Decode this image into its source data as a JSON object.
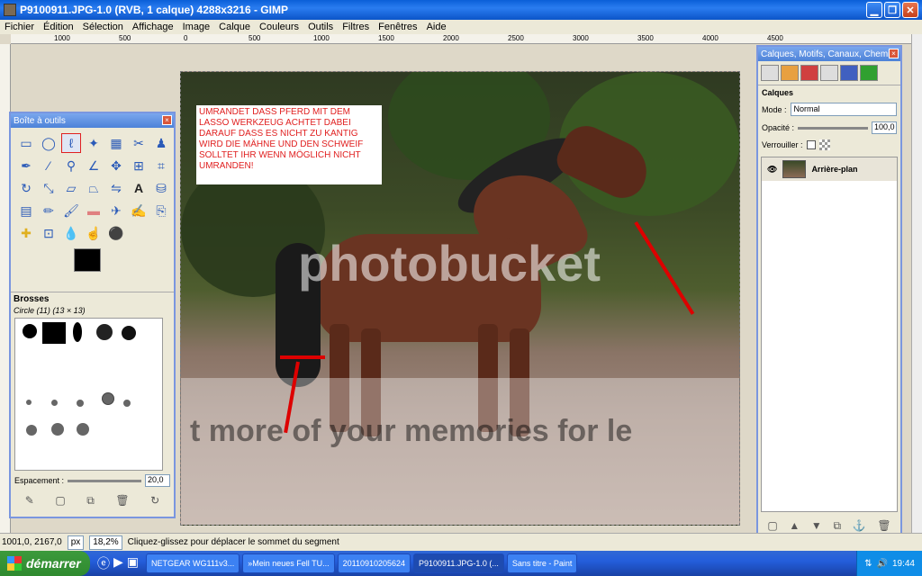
{
  "window": {
    "title": "P9100911.JPG-1.0 (RVB, 1 calque) 4288x3216 - GIMP",
    "controls": [
      "minimize-icon",
      "maximize-icon",
      "close-icon"
    ]
  },
  "menu": [
    "Fichier",
    "Édition",
    "Sélection",
    "Affichage",
    "Image",
    "Calque",
    "Couleurs",
    "Outils",
    "Filtres",
    "Fenêtres",
    "Aide"
  ],
  "ruler": {
    "ticks": [
      "1000",
      "500",
      "0",
      "500",
      "1000",
      "1500",
      "2000",
      "2500",
      "3000",
      "3500",
      "4000",
      "4500"
    ]
  },
  "canvas": {
    "note": "UMRANDET DASS PFERD MIT DEM LASSO WERKZEUG ACHTET DABEI DARAUF DASS ES NICHT ZU KANTIG WIRD DIE MÄHNE UND DEN SCHWEIF SOLLTET IHR WENN MÖGLICH NICHT UMRANDEN!",
    "watermark": "photobucket",
    "watermark_tagline": "t more of your memories for le",
    "annotation_color": "#dd0000"
  },
  "toolbox": {
    "title": "Boîte à outils",
    "close": "×",
    "tools": [
      "rect-select-icon",
      "ellipse-select-icon",
      "lasso-select-icon",
      "fuzzy-select-icon",
      "color-select-icon",
      "scissors-icon",
      "foreground-select-icon",
      "paths-icon",
      "color-picker-icon",
      "zoom-icon",
      "measure-icon",
      "move-icon",
      "align-icon",
      "crop-icon",
      "rotate-icon",
      "scale-icon",
      "shear-icon",
      "perspective-icon",
      "flip-icon",
      "text-icon",
      "bucket-fill-icon",
      "gradient-icon",
      "pencil-icon",
      "paintbrush-icon",
      "eraser-icon",
      "airbrush-icon",
      "ink-icon",
      "clone-icon",
      "heal-icon",
      "perspective-clone-icon",
      "blur-icon",
      "smudge-icon",
      "dodge-burn-icon"
    ],
    "selected_tool": "lasso-select-icon"
  },
  "brushes": {
    "title": "Brosses",
    "current": "Circle (11) (13 × 13)",
    "spacing_label": "Espacement :",
    "spacing_value": "20,0",
    "spacing_level": 20
  },
  "layers_dock": {
    "title": "Calques, Motifs, Canaux, Chemi...",
    "section": "Calques",
    "mode_label": "Mode :",
    "mode_value": "Normal",
    "opacity_label": "Opacité :",
    "opacity_value": "100,0",
    "opacity_level": 100,
    "lock_label": "Verrouiller :",
    "layer_name": "Arrière-plan"
  },
  "status": {
    "coords": "1001,0, 2167,0",
    "unit": "px",
    "zoom": "18,2%",
    "message": "Cliquez-glissez pour déplacer le sommet du segment"
  },
  "taskbar": {
    "start": "démarrer",
    "tasks": [
      "NETGEAR WG111v3...",
      "»Mein neues Fell TU...",
      "20110910205624",
      "P9100911.JPG-1.0 (...",
      "Sans titre - Paint"
    ],
    "active_task": 3,
    "clock": "19:44"
  }
}
